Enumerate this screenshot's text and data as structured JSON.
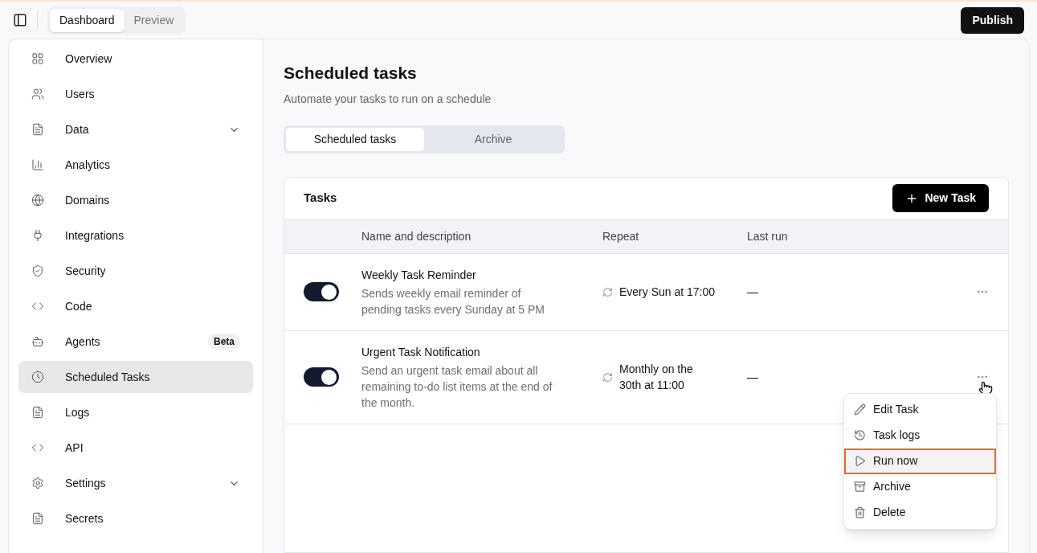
{
  "top_bar": {
    "view_tabs": [
      {
        "label": "Dashboard",
        "selected": true
      },
      {
        "label": "Preview",
        "selected": false
      }
    ],
    "publish_button": "Publish"
  },
  "sidebar": {
    "items": [
      {
        "label": "Overview",
        "selected": false
      },
      {
        "label": "Users",
        "selected": false
      },
      {
        "label": "Data",
        "selected": false,
        "expandable": true
      },
      {
        "label": "Analytics",
        "selected": false
      },
      {
        "label": "Domains",
        "selected": false
      },
      {
        "label": "Integrations",
        "selected": false
      },
      {
        "label": "Security",
        "selected": false
      },
      {
        "label": "Code",
        "selected": false
      },
      {
        "label": "Agents",
        "selected": false,
        "badge": "Beta"
      },
      {
        "label": "Scheduled Tasks",
        "selected": true
      },
      {
        "label": "Logs",
        "selected": false
      },
      {
        "label": "API",
        "selected": false
      },
      {
        "label": "Settings",
        "selected": false,
        "expandable": true
      },
      {
        "label": "Secrets",
        "selected": false
      }
    ]
  },
  "page": {
    "title": "Scheduled tasks",
    "subtitle": "Automate your tasks to run on a schedule",
    "tabs": [
      {
        "label": "Scheduled tasks",
        "selected": true
      },
      {
        "label": "Archive",
        "selected": false
      }
    ]
  },
  "tasks_card": {
    "title": "Tasks",
    "new_button": "New Task",
    "columns": [
      "Name and description",
      "Repeat",
      "Last run"
    ],
    "rows": [
      {
        "on": true,
        "name": "Weekly Task Reminder",
        "description": "Sends weekly email reminder of pending tasks every Sunday at 5 PM",
        "repeat": "Every Sun at 17:00",
        "last_run": "—"
      },
      {
        "on": true,
        "name": "Urgent Task Notification",
        "description": "Send an urgent task email about all remaining to-do list items at the end of the month.",
        "repeat": "Monthly on the 30th at 11:00",
        "last_run": "—"
      }
    ],
    "menu": [
      {
        "label": "Edit Task",
        "highlighted": false
      },
      {
        "label": "Task logs",
        "highlighted": false
      },
      {
        "label": "Run now",
        "highlighted": true
      },
      {
        "label": "Archive",
        "highlighted": false
      },
      {
        "label": "Delete",
        "highlighted": false
      }
    ]
  }
}
